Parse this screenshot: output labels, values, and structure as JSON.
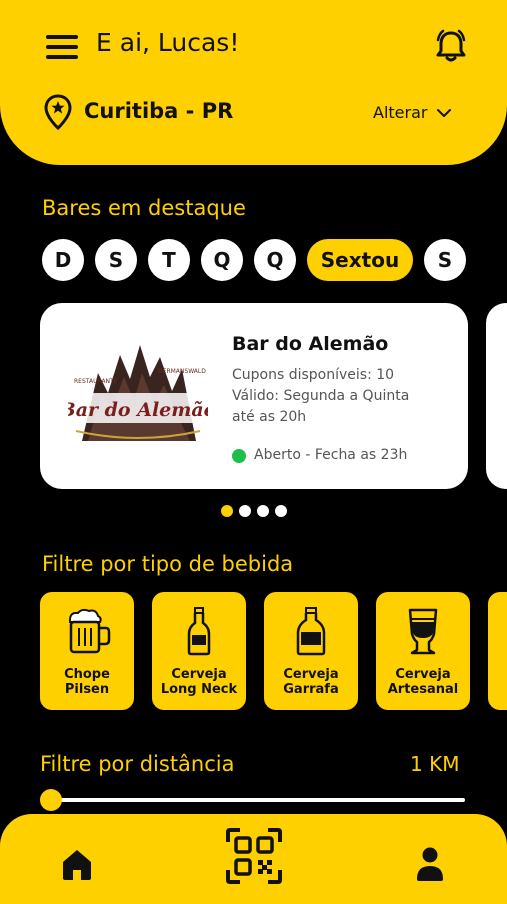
{
  "header": {
    "greeting": "E ai, Lucas!",
    "city": "Curitiba - PR",
    "change_label": "Alterar",
    "menu_icon": "menu-icon",
    "notification_icon": "bell-icon",
    "location_icon": "location-pin-icon",
    "accent_color": "#FFD000"
  },
  "featured": {
    "title": "Bares em destaque",
    "days": [
      {
        "label": "D"
      },
      {
        "label": "S"
      },
      {
        "label": "T"
      },
      {
        "label": "Q"
      },
      {
        "label": "Q"
      },
      {
        "label": "Sextou",
        "selected": true
      },
      {
        "label": "S"
      }
    ],
    "card": {
      "name": "Bar do Alemão",
      "coupons": "Cupons disponíveis: 10",
      "validity_1": "Válido: Segunda a Quinta",
      "validity_2": "até as 20h",
      "status": "Aberto - Fecha as 23h",
      "status_color": "#1DBE4A",
      "logo_top_left": "RESTAURANTE",
      "logo_top_right": "GERMANSWALD",
      "logo_main": "Bar do Alemão"
    },
    "carousel_pages": 4,
    "carousel_active": 1
  },
  "drink_filter": {
    "title": "Filtre por tipo de bebida",
    "items": [
      {
        "line1": "Chope",
        "line2": "Pilsen",
        "icon": "beer-mug-icon"
      },
      {
        "line1": "Cerveja",
        "line2": "Long Neck",
        "icon": "long-neck-bottle-icon"
      },
      {
        "line1": "Cerveja",
        "line2": "Garrafa",
        "icon": "beer-bottle-icon"
      },
      {
        "line1": "Cerveja",
        "line2": "Artesanal",
        "icon": "craft-beer-glass-icon"
      }
    ]
  },
  "distance_filter": {
    "title": "Filtre por distância",
    "value": "1 KM",
    "level": 0
  },
  "bottom_nav": {
    "home_icon": "home-icon",
    "qr_icon": "qr-code-icon",
    "profile_icon": "user-icon"
  }
}
